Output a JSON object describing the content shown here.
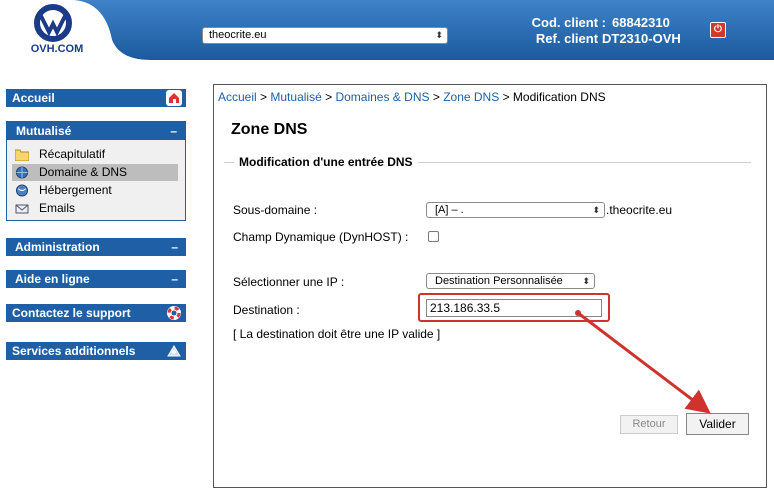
{
  "header": {
    "logo_text": "OVH.COM",
    "site_select": "theocrite.eu",
    "cod_client_label": "Cod. client :",
    "cod_client_value": "68842310",
    "ref_client_label": "Ref. client :",
    "ref_client_value": "DT2310-OVH",
    "logout_symbol": "⏻"
  },
  "sidebar": {
    "accueil": "Accueil",
    "mutualise": "Mutualisé",
    "mutualise_items": [
      {
        "label": "Récapitulatif",
        "icon": "folder-icon"
      },
      {
        "label": "Domaine & DNS",
        "icon": "globe-icon"
      },
      {
        "label": "Hébergement",
        "icon": "server-icon"
      },
      {
        "label": "Emails",
        "icon": "email-icon"
      }
    ],
    "administration": "Administration",
    "aide": "Aide en ligne",
    "support": "Contactez le support",
    "services": "Services additionnels",
    "collapse_symbol": "–"
  },
  "main": {
    "breadcrumb": {
      "accueil": "Accueil",
      "mutualise": "Mutualisé",
      "domaines": "Domaines & DNS",
      "zone": "Zone DNS",
      "current": "Modification DNS",
      "separator": ">"
    },
    "title": "Zone DNS",
    "legend": "Modification d'une entrée DNS",
    "subdomain_label": "Sous-domaine :",
    "subdomain_value": "[A] – .",
    "subdomain_suffix": ".theocrite.eu",
    "dynamic_label": "Champ Dynamique (DynHOST) :",
    "ip_label": "Sélectionner une IP :",
    "ip_value": "Destination Personnalisée",
    "destination_label": "Destination :",
    "destination_value": "213.186.33.5",
    "hint": "[ La destination doit être une IP valide ]",
    "retour": "Retour",
    "valider": "Valider"
  },
  "colors": {
    "brand_blue": "#1f5fa5",
    "annotation_red": "#d0332d"
  }
}
